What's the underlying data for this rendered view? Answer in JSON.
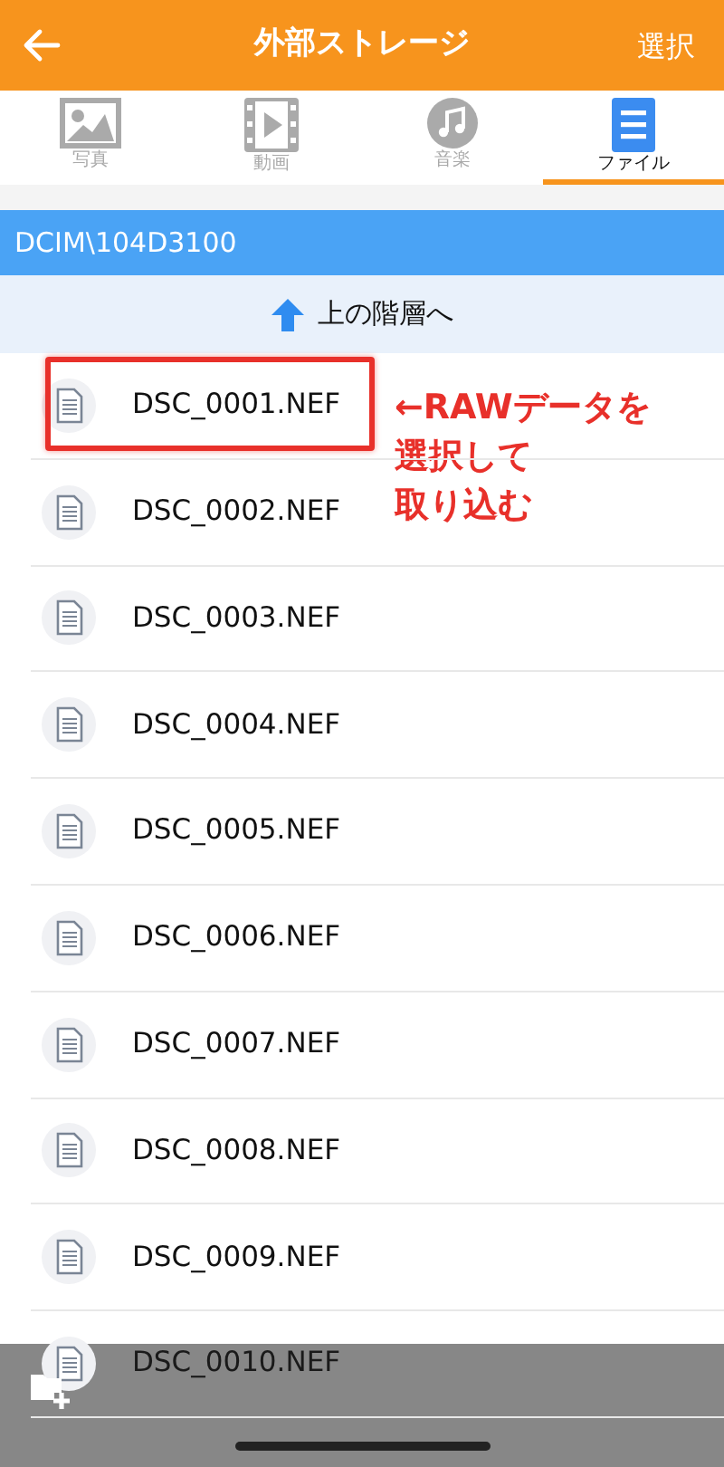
{
  "header": {
    "title": "外部ストレージ",
    "action": "選択"
  },
  "tabs": [
    {
      "kind": "photo",
      "label": "写真",
      "selected": false
    },
    {
      "kind": "video",
      "label": "動画",
      "selected": false
    },
    {
      "kind": "music",
      "label": "音楽",
      "selected": false
    },
    {
      "kind": "file",
      "label": "ファイル",
      "selected": true
    }
  ],
  "path": "DCIM\\104D3100",
  "parent_link": "上の階層へ",
  "files": [
    {
      "name": "DSC_0001.NEF",
      "annotated": true
    },
    {
      "name": "DSC_0002.NEF",
      "annotated": false
    },
    {
      "name": "DSC_0003.NEF",
      "annotated": false
    },
    {
      "name": "DSC_0004.NEF",
      "annotated": false
    },
    {
      "name": "DSC_0005.NEF",
      "annotated": false
    },
    {
      "name": "DSC_0006.NEF",
      "annotated": false
    },
    {
      "name": "DSC_0007.NEF",
      "annotated": false
    },
    {
      "name": "DSC_0008.NEF",
      "annotated": false
    },
    {
      "name": "DSC_0009.NEF",
      "annotated": false
    },
    {
      "name": "DSC_0010.NEF",
      "annotated": false
    }
  ],
  "annotation": [
    "←RAWデータを",
    "選択して",
    "取り込む"
  ]
}
